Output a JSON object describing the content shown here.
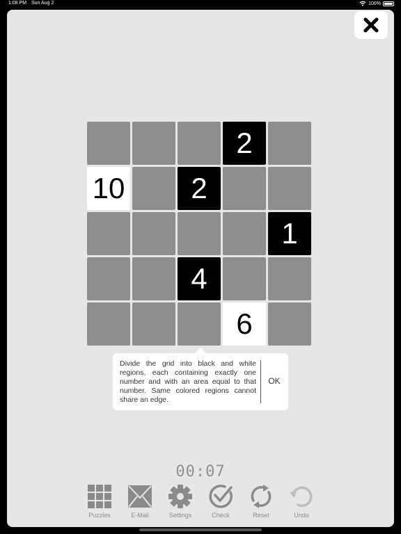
{
  "status_bar": {
    "time": "1:08 PM",
    "date": "Sun Aug 2",
    "battery": "100%"
  },
  "puzzle": {
    "cells": [
      {
        "color": "gray",
        "value": ""
      },
      {
        "color": "gray",
        "value": ""
      },
      {
        "color": "gray",
        "value": ""
      },
      {
        "color": "black",
        "value": "2"
      },
      {
        "color": "gray",
        "value": ""
      },
      {
        "color": "white",
        "value": "10"
      },
      {
        "color": "gray",
        "value": ""
      },
      {
        "color": "black",
        "value": "2"
      },
      {
        "color": "gray",
        "value": ""
      },
      {
        "color": "gray",
        "value": ""
      },
      {
        "color": "gray",
        "value": ""
      },
      {
        "color": "gray",
        "value": ""
      },
      {
        "color": "gray",
        "value": ""
      },
      {
        "color": "gray",
        "value": ""
      },
      {
        "color": "black",
        "value": "1"
      },
      {
        "color": "gray",
        "value": ""
      },
      {
        "color": "gray",
        "value": ""
      },
      {
        "color": "black",
        "value": "4"
      },
      {
        "color": "gray",
        "value": ""
      },
      {
        "color": "gray",
        "value": ""
      },
      {
        "color": "gray",
        "value": ""
      },
      {
        "color": "gray",
        "value": ""
      },
      {
        "color": "gray",
        "value": ""
      },
      {
        "color": "white",
        "value": "6"
      },
      {
        "color": "gray",
        "value": ""
      }
    ]
  },
  "popup": {
    "text": "Divide the grid into black and white regions, each containing exactly one number and with an area equal to that number. Same colored regions cannot share an edge.",
    "ok_label": "OK"
  },
  "timer": "00:07",
  "toolbar": {
    "puzzles": "Puzzles",
    "email": "E-Mail",
    "settings": "Settings",
    "check": "Check",
    "reset": "Reset",
    "undo": "Undo"
  },
  "colors": {
    "sheet": "#e6e6e6",
    "cell_gray": "#8e8e8e",
    "icon_gray": "#8a8a8a",
    "icon_disabled": "#bdbdbd"
  }
}
